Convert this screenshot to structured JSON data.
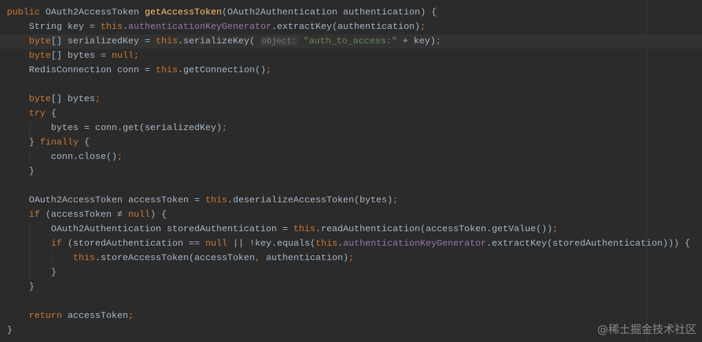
{
  "colors": {
    "background": "#2b2b2b",
    "keyword": "#cc7832",
    "text": "#a9b7c6",
    "field": "#9876aa",
    "method_decl": "#ffc66d",
    "string": "#6a8759"
  },
  "current_line": 2,
  "lines": [
    {
      "indent": 0,
      "tokens": [
        {
          "t": "public ",
          "c": "kw"
        },
        {
          "t": "OAuth2AccessToken "
        },
        {
          "t": "getAccessToken",
          "c": "fn"
        },
        {
          "t": "(OAuth2Authentication authentication) {"
        }
      ]
    },
    {
      "indent": 1,
      "tokens": [
        {
          "t": "String key = "
        },
        {
          "t": "this",
          "c": "kw"
        },
        {
          "t": "."
        },
        {
          "t": "authenticationKeyGenerator",
          "c": "fld"
        },
        {
          "t": ".extractKey(authentication)"
        },
        {
          "t": ";",
          "c": "kw"
        }
      ]
    },
    {
      "indent": 1,
      "tokens": [
        {
          "t": "byte",
          "c": "kw"
        },
        {
          "t": "[] serializedKey = "
        },
        {
          "t": "this",
          "c": "kw"
        },
        {
          "t": ".serializeKey( "
        },
        {
          "t": "object:",
          "c": "hint"
        },
        {
          "t": " "
        },
        {
          "t": "\"auth_to_access:\"",
          "c": "str"
        },
        {
          "t": " + key)"
        },
        {
          "t": ";",
          "c": "kw"
        }
      ]
    },
    {
      "indent": 1,
      "tokens": [
        {
          "t": "byte",
          "c": "kw"
        },
        {
          "t": "[] bytes = "
        },
        {
          "t": "null",
          "c": "kw"
        },
        {
          "t": ";",
          "c": "kw"
        }
      ]
    },
    {
      "indent": 1,
      "tokens": [
        {
          "t": "RedisConnection conn = "
        },
        {
          "t": "this",
          "c": "kw"
        },
        {
          "t": ".getConnection()"
        },
        {
          "t": ";",
          "c": "kw"
        }
      ]
    },
    {
      "indent": 1,
      "tokens": []
    },
    {
      "indent": 1,
      "tokens": [
        {
          "t": "byte",
          "c": "kw"
        },
        {
          "t": "[] bytes"
        },
        {
          "t": ";",
          "c": "kw"
        }
      ]
    },
    {
      "indent": 1,
      "tokens": [
        {
          "t": "try ",
          "c": "kw"
        },
        {
          "t": "{"
        }
      ]
    },
    {
      "indent": 2,
      "tokens": [
        {
          "t": "bytes = conn.get(serializedKey)"
        },
        {
          "t": ";",
          "c": "kw"
        }
      ]
    },
    {
      "indent": 1,
      "tokens": [
        {
          "t": "} "
        },
        {
          "t": "finally ",
          "c": "kw"
        },
        {
          "t": "{"
        }
      ]
    },
    {
      "indent": 2,
      "tokens": [
        {
          "t": "conn.close()"
        },
        {
          "t": ";",
          "c": "kw"
        }
      ]
    },
    {
      "indent": 1,
      "tokens": [
        {
          "t": "}"
        }
      ]
    },
    {
      "indent": 1,
      "tokens": []
    },
    {
      "indent": 1,
      "tokens": [
        {
          "t": "OAuth2AccessToken accessToken = "
        },
        {
          "t": "this",
          "c": "kw"
        },
        {
          "t": ".deserializeAccessToken(bytes)"
        },
        {
          "t": ";",
          "c": "kw"
        }
      ]
    },
    {
      "indent": 1,
      "tokens": [
        {
          "t": "if ",
          "c": "kw"
        },
        {
          "t": "(accessToken ≠ "
        },
        {
          "t": "null",
          "c": "kw"
        },
        {
          "t": ") {"
        }
      ]
    },
    {
      "indent": 2,
      "tokens": [
        {
          "t": "OAuth2Authentication storedAuthentication = "
        },
        {
          "t": "this",
          "c": "kw"
        },
        {
          "t": ".readAuthentication(accessToken.getValue())"
        },
        {
          "t": ";",
          "c": "kw"
        }
      ]
    },
    {
      "indent": 2,
      "tokens": [
        {
          "t": "if ",
          "c": "kw"
        },
        {
          "t": "(storedAuthentication == "
        },
        {
          "t": "null ",
          "c": "kw"
        },
        {
          "t": "|| !key.equals("
        },
        {
          "t": "this",
          "c": "kw"
        },
        {
          "t": "."
        },
        {
          "t": "authenticationKeyGenerator",
          "c": "fld"
        },
        {
          "t": ".extractKey(storedAuthentication))) {"
        }
      ]
    },
    {
      "indent": 3,
      "tokens": [
        {
          "t": "this",
          "c": "kw"
        },
        {
          "t": ".storeAccessToken(accessToken"
        },
        {
          "t": ", ",
          "c": "kw"
        },
        {
          "t": "authentication)"
        },
        {
          "t": ";",
          "c": "kw"
        }
      ]
    },
    {
      "indent": 2,
      "tokens": [
        {
          "t": "}"
        }
      ]
    },
    {
      "indent": 1,
      "tokens": [
        {
          "t": "}"
        }
      ]
    },
    {
      "indent": 1,
      "tokens": []
    },
    {
      "indent": 1,
      "tokens": [
        {
          "t": "return ",
          "c": "kw"
        },
        {
          "t": "accessToken"
        },
        {
          "t": ";",
          "c": "kw"
        }
      ]
    },
    {
      "indent": 0,
      "tokens": [
        {
          "t": "}"
        }
      ]
    }
  ],
  "watermark": "@稀土掘金技术社区"
}
